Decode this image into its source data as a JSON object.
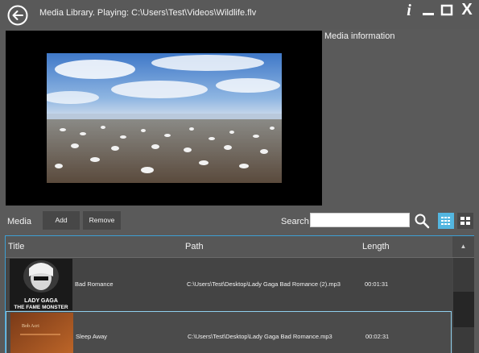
{
  "window": {
    "title": "Media Library. Playing: C:\\Users\\Test\\Videos\\Wildlife.flv",
    "info_glyph": "i",
    "min_glyph": "—",
    "close_glyph": "X"
  },
  "player": {
    "info_heading": "Media information"
  },
  "toolbar": {
    "media_label": "Media",
    "add_label": "Add",
    "remove_label": "Remove",
    "search_label": "Search",
    "search_value": "",
    "search_placeholder": ""
  },
  "table": {
    "columns": [
      "Title",
      "Path",
      "Length"
    ],
    "sort_glyph": "▲",
    "rows": [
      {
        "title": "Bad Romance",
        "path": "C:\\Users\\Test\\Desktop\\Lady Gaga Bad Romance (2).mp3",
        "length": "00:01:31",
        "art_line1": "LADY GAGA",
        "art_line2": "THE FAME MONSTER"
      },
      {
        "title": "Sleep Away",
        "path": "C:\\Users\\Test\\Desktop\\Lady Gaga Bad Romance.mp3",
        "length": "00:02:31",
        "art_line1": "Bob Acri",
        "art_line2": ""
      }
    ]
  },
  "colors": {
    "background": "#5a5a5a",
    "accent": "#53b6e0",
    "selection_border": "#8fd0ee"
  }
}
